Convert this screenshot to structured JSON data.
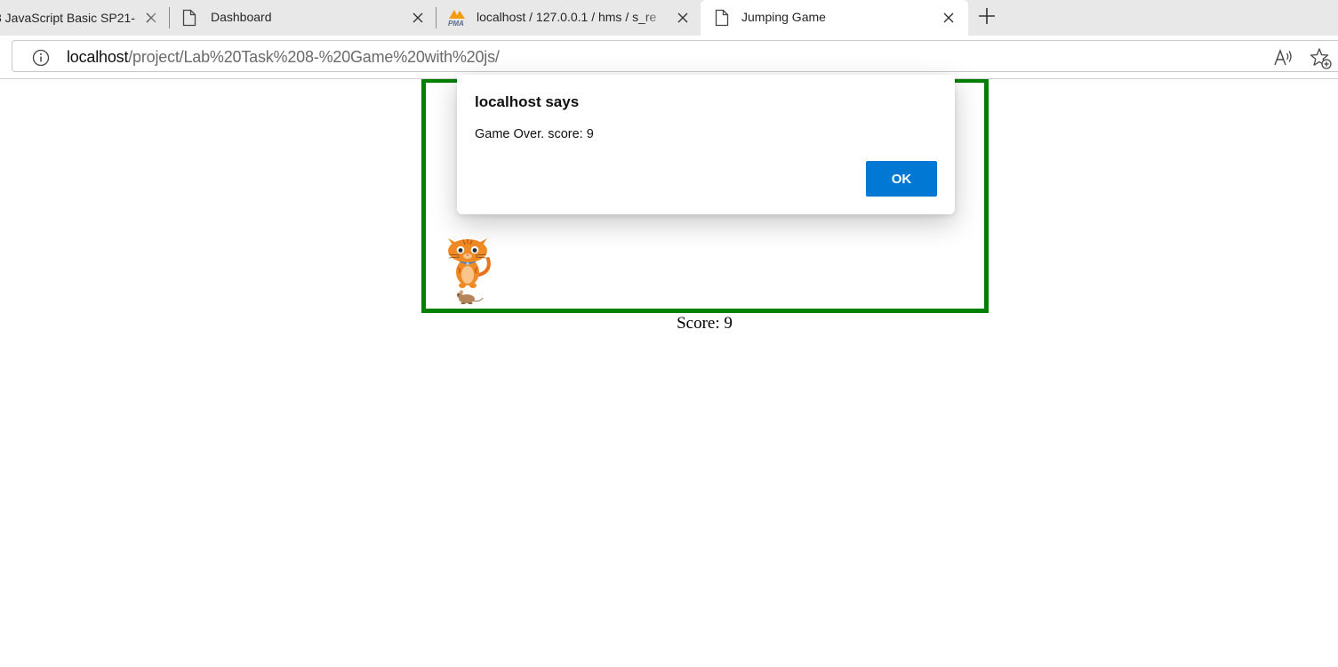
{
  "browser": {
    "tabs": [
      {
        "title": "3 JavaScript Basic SP21-",
        "icon": "page-icon",
        "active": false
      },
      {
        "title": "Dashboard",
        "icon": "page-icon",
        "active": false
      },
      {
        "title": "localhost / 127.0.0.1 / hms / s_re",
        "icon": "phpmyadmin-icon",
        "active": false
      },
      {
        "title": "Jumping Game",
        "icon": "page-icon",
        "active": true
      }
    ],
    "new_tab_icon": "plus-icon",
    "address": {
      "host": "localhost",
      "path": "/project/Lab%20Task%208-%20Game%20with%20js/",
      "icons": [
        "info-icon",
        "read-aloud-icon",
        "add-favorite-icon"
      ]
    }
  },
  "page": {
    "score_text": "Score: 9",
    "game_border_color": "#008000",
    "sprites": [
      "cat-sprite",
      "mouse-sprite"
    ]
  },
  "dialog": {
    "title": "localhost says",
    "message": "Game Over. score: 9",
    "ok_label": "OK",
    "ok_color": "#0078d4"
  }
}
